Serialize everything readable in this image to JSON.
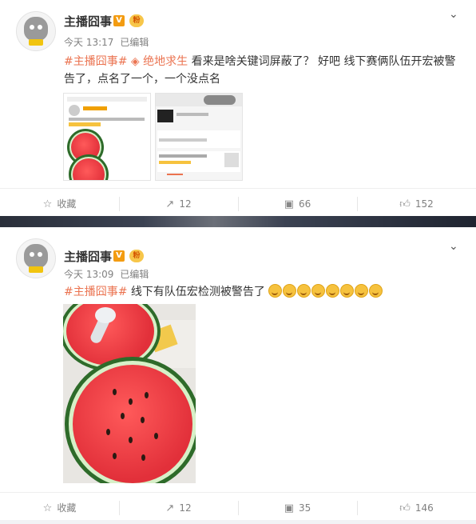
{
  "posts": [
    {
      "author": "主播囧事",
      "v_badge": "V",
      "fan_badge": "粉",
      "time": "今天 13:17",
      "edited": "已编辑",
      "topic": "#主播囧事#",
      "super_topic": "绝地求生",
      "text": " 看来是啥关键词屏蔽了？ 好吧 线下赛俩队伍开宏被警告了，点名了一个，一个没点名",
      "actions": {
        "favorite": "收藏",
        "repost": "12",
        "comment": "66",
        "like": "152"
      }
    },
    {
      "author": "主播囧事",
      "v_badge": "V",
      "fan_badge": "粉",
      "time": "今天 13:09",
      "edited": "已编辑",
      "topic": "#主播囧事#",
      "text": " 线下有队伍宏检测被警告了",
      "actions": {
        "favorite": "收藏",
        "repost": "12",
        "comment": "35",
        "like": "146"
      }
    }
  ],
  "icons": {
    "favorite": "star-icon",
    "repost": "repost-icon",
    "comment": "comment-icon",
    "like": "thumbs-up-icon",
    "more": "chevron-down-icon"
  },
  "colors": {
    "topic": "#eb7350",
    "v_badge": "#f39c12",
    "meta": "#808080"
  }
}
